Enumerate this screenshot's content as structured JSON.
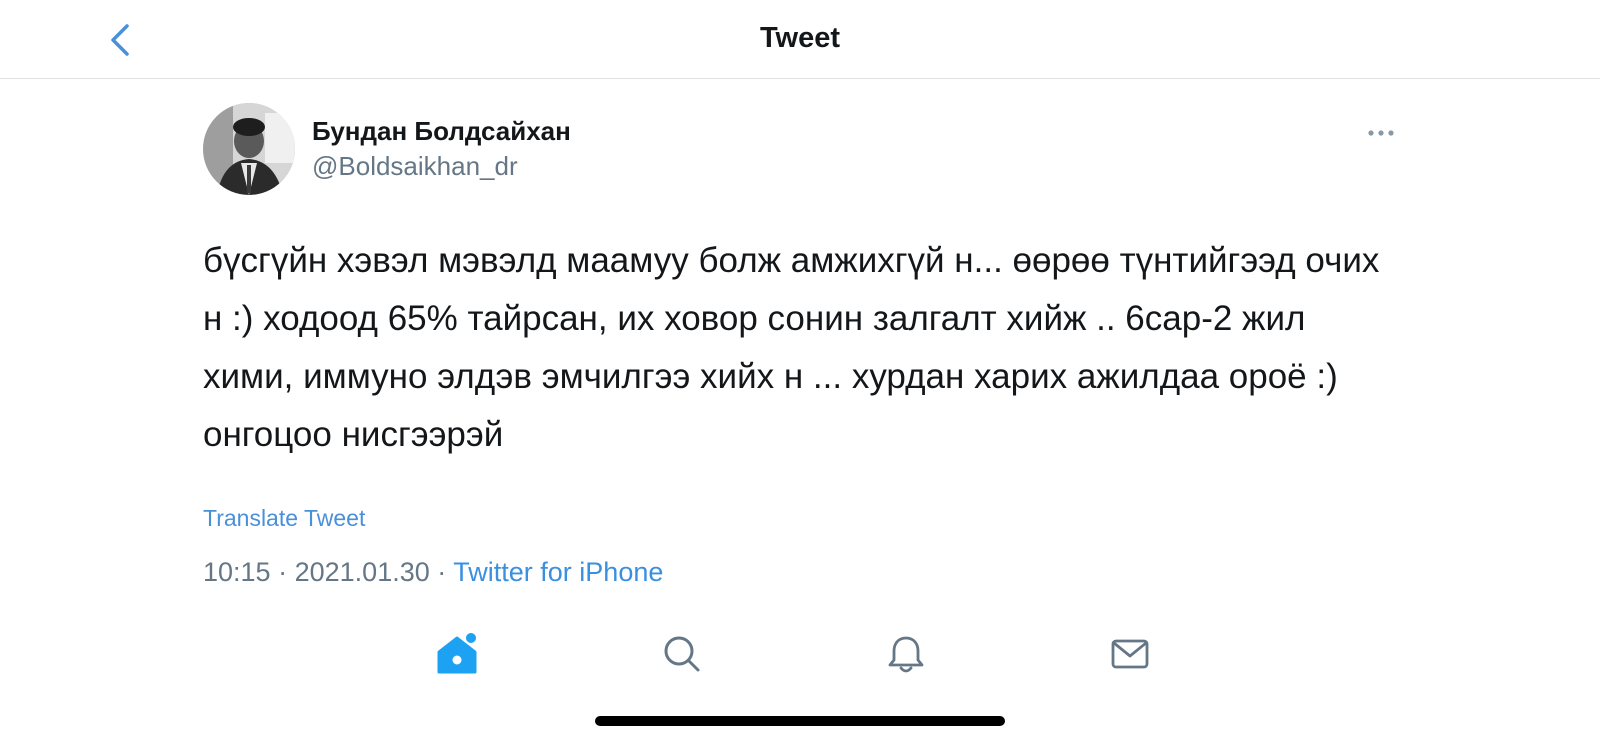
{
  "header": {
    "title": "Tweet",
    "back_icon": "chevron-left-icon"
  },
  "tweet": {
    "author": {
      "name": "Бундан Болдсайхан",
      "handle": "@Boldsaikhan_dr",
      "avatar_icon": "user-avatar"
    },
    "more_icon": "more-horizontal-icon",
    "text": "бүсгүйн хэвэл мэвэлд маамуу болж амжихгүй н... өөрөө түнтийгээд очих н :) ходоод 65% тайрсан, их ховор сонин залгалт хийж .. 6сар-2 жил хими, иммуно элдэв эмчилгээ хийх н ... хурдан харих ажилдаа ороё :) онгоцоо нисгээрэй",
    "translate_label": "Translate Tweet",
    "time": "10:15",
    "separator": "·",
    "date": "2021.01.30",
    "source": "Twitter for iPhone"
  },
  "tab_bar": {
    "items": [
      {
        "name": "home",
        "icon": "home-icon",
        "active": true,
        "has_badge": true
      },
      {
        "name": "search",
        "icon": "search-icon",
        "active": false
      },
      {
        "name": "notifications",
        "icon": "bell-icon",
        "active": false
      },
      {
        "name": "messages",
        "icon": "mail-icon",
        "active": false
      }
    ]
  },
  "colors": {
    "accent": "#1da1f2",
    "link": "#3a8fe0",
    "text": "#14171a",
    "secondary": "#657786",
    "icon_inactive": "#657786",
    "divider": "#dfe3e6"
  }
}
